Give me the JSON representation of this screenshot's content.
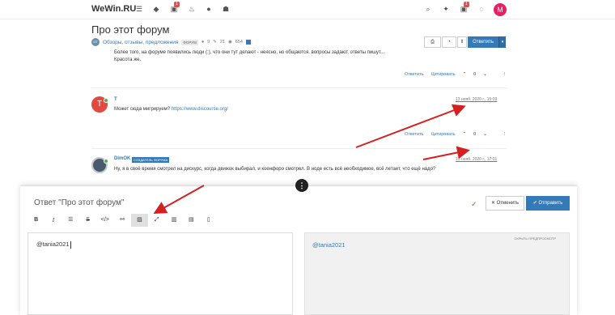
{
  "navbar": {
    "brand": "WeWin.RU",
    "unread_badge": "1",
    "notifications_badge": "1",
    "user_avatar_letter": "M",
    "icons": [
      "list-icon",
      "tags-icon",
      "unread-icon",
      "fire-icon",
      "user-icon",
      "group-icon",
      "search-icon",
      "lightbulb-icon",
      "bell-icon",
      "chat-icon"
    ]
  },
  "topic": {
    "title": "Про этот форум",
    "category_icon": "ОТ",
    "category": "Обзоры, отзывы, предложения",
    "tag": "форум",
    "posters": "9",
    "posts": "21",
    "views": "654",
    "reply_button": "Ответить"
  },
  "posts": [
    {
      "text_line1": "Более того, на форуме появились люди (:), что они тут делают - неясно, но общаются. вопросы задают, ответы пишут...",
      "text_line2": "Красота же.",
      "reply": "Ответить",
      "quote": "Цитировать",
      "votes": "0"
    },
    {
      "avatar_letter": "T",
      "author": "T",
      "time": "13 нояб. 2020 г., 15:09",
      "text": "Может сюда мигрируем?",
      "link": "https://www.discourse.org/",
      "reply": "Ответить",
      "quote": "Цитировать",
      "votes": "0"
    },
    {
      "author": "DimOK",
      "role": "СОЗДАТЕЛЬ ФОРУМА",
      "time": "13 нояб. 2020 г., 17:01",
      "text": "Ну, я в своё время смотрел на дискурс, когда движок выбирал, и коенфоро смотрел. В ноде есть всё необходимое, всё летает, что ещё надо?"
    }
  ],
  "composer": {
    "title": "Ответ \"Про этот форум\"",
    "cancel": "Отменить",
    "submit": "Отправить",
    "editor_value": "@tania2021",
    "preview_value": "@tania2021",
    "hide_preview": "скрыть предпросмотр",
    "toolbar": [
      "bold-icon",
      "italic-icon",
      "list-icon",
      "strikethrough-icon",
      "code-icon",
      "link-icon",
      "image-icon",
      "fullscreen-icon",
      "chart-icon",
      "upload-image-icon",
      "upload-file-icon"
    ]
  },
  "colors": {
    "accent": "#337ab7",
    "annotation": "#d42020",
    "badge": "#d9534f",
    "user_avatar": "#e91e63",
    "post_avatar": "#e04a3f"
  }
}
